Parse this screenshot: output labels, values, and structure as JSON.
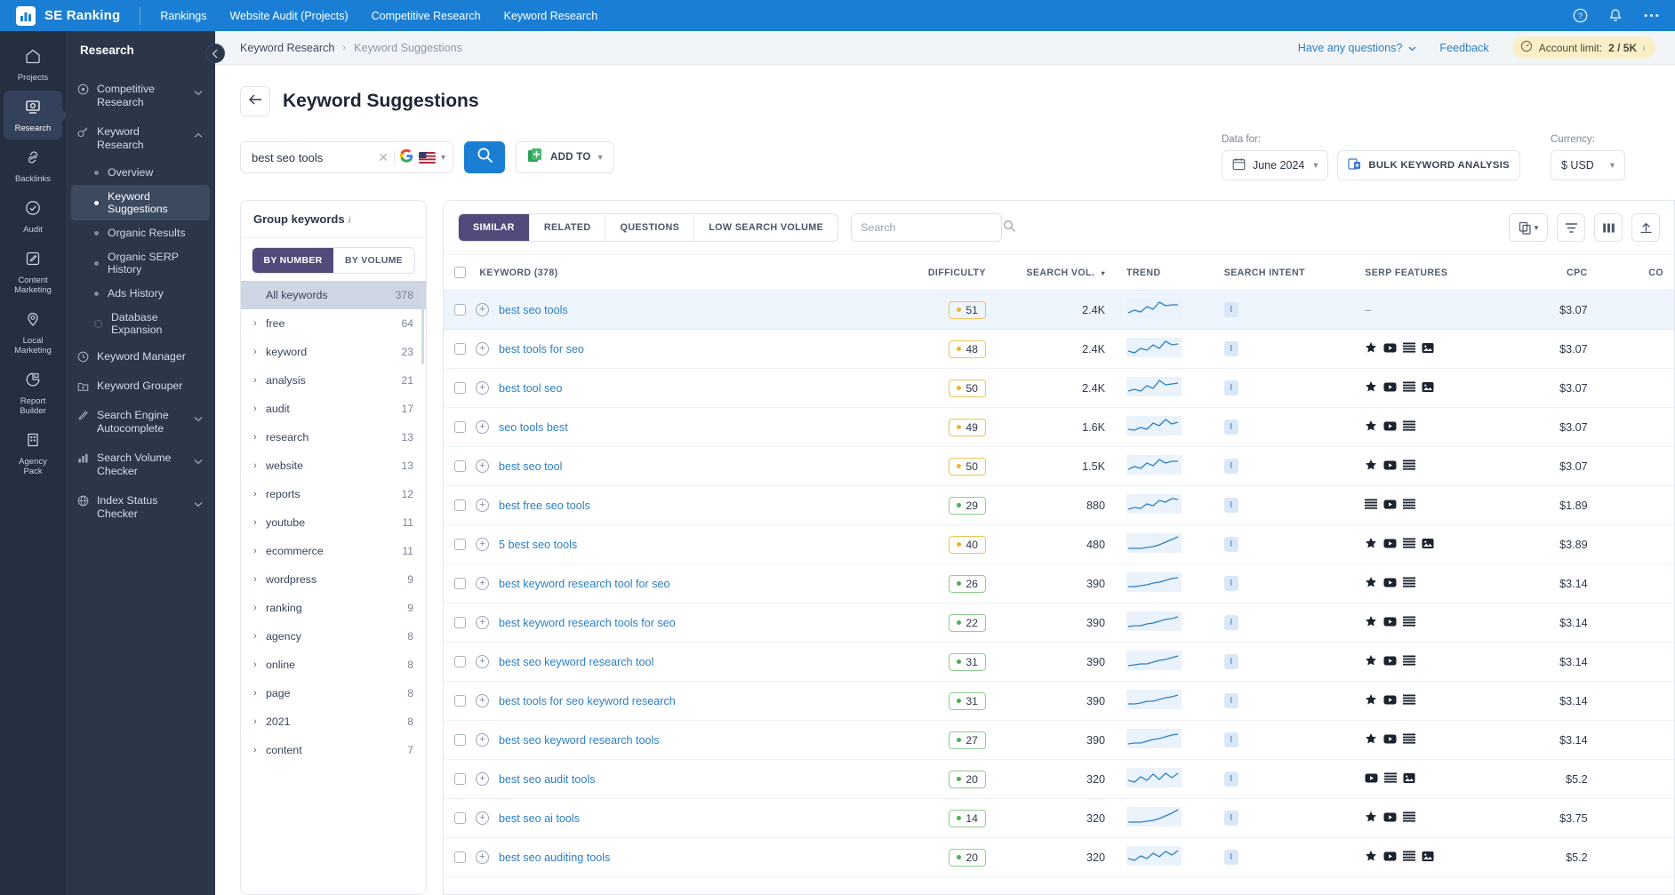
{
  "topbar": {
    "brand": "SE Ranking",
    "logo_icon": "bar-chart-icon",
    "nav": [
      {
        "label": "Rankings"
      },
      {
        "label": "Website Audit (Projects)"
      },
      {
        "label": "Competitive Research"
      },
      {
        "label": "Keyword Research"
      }
    ],
    "icons": [
      {
        "name": "help-icon",
        "glyph": "?"
      },
      {
        "name": "notifications-bell-icon",
        "glyph": "⚑"
      },
      {
        "name": "more-menu-icon",
        "glyph": "⋯"
      }
    ]
  },
  "rail": [
    {
      "label": "Projects",
      "icon": "home-icon"
    },
    {
      "label": "Research",
      "icon": "research-monitor-icon",
      "active": true
    },
    {
      "label": "Backlinks",
      "icon": "link-icon"
    },
    {
      "label": "Audit",
      "icon": "check-circle-icon"
    },
    {
      "label": "Content\nMarketing",
      "icon": "pencil-square-icon"
    },
    {
      "label": "Local\nMarketing",
      "icon": "map-pin-icon"
    },
    {
      "label": "Report\nBuilder",
      "icon": "pie-chart-icon"
    },
    {
      "label": "Agency\nPack",
      "icon": "building-icon"
    }
  ],
  "subnav": {
    "title": "Research",
    "collapse_icon": "chevron-left-icon",
    "groups": [
      {
        "label": "Competitive Research",
        "icon": "target-icon",
        "chevron": "chevron-down-icon"
      },
      {
        "label": "Keyword Research",
        "icon": "key-icon",
        "chevron": "chevron-up-icon",
        "expanded": true
      }
    ],
    "keyword_research_items": [
      {
        "label": "Overview",
        "active": false
      },
      {
        "label": "Keyword Suggestions",
        "active": true
      },
      {
        "label": "Organic Results",
        "active": false
      },
      {
        "label": "Organic SERP History",
        "active": false
      },
      {
        "label": "Ads History",
        "active": false
      },
      {
        "label": "Database Expansion",
        "active": false,
        "dotted": true
      }
    ],
    "bottom_groups": [
      {
        "label": "Keyword Manager",
        "icon": "clock-icon",
        "chevron": ""
      },
      {
        "label": "Keyword Grouper",
        "icon": "folder-plus-icon",
        "chevron": ""
      },
      {
        "label": "Search Engine Autocomplete",
        "icon": "pen-icon",
        "chevron": "chevron-down-icon"
      },
      {
        "label": "Search Volume Checker",
        "icon": "bars-icon",
        "chevron": "chevron-down-icon"
      },
      {
        "label": "Index Status Checker",
        "icon": "globe-icon",
        "chevron": "chevron-down-icon"
      }
    ]
  },
  "breadcrumb": {
    "parent": "Keyword Research",
    "separator": "›",
    "current": "Keyword Suggestions",
    "have_questions": "Have any questions?",
    "feedback": "Feedback",
    "account_limit_label": "Account limit:",
    "account_limit_value": "2 / 5K",
    "account_limit_sup": "i",
    "speedometer_icon": "gauge-icon"
  },
  "page": {
    "back_icon": "arrow-left-icon",
    "title": "Keyword Suggestions"
  },
  "search": {
    "keyword_value": "best seo tools",
    "clear_icon": "close-icon",
    "engine_icon": "google-icon",
    "country_flag": "us-flag-icon",
    "search_icon": "search-icon",
    "add_to_label": "ADD TO",
    "add_to_icon": "add-to-list-icon"
  },
  "controls": {
    "data_for_caption": "Data for:",
    "date_value": "June 2024",
    "calendar_icon": "calendar-icon",
    "bulk_label": "BULK KEYWORD ANALYSIS",
    "bulk_icon": "bulk-analysis-icon",
    "currency_caption": "Currency:",
    "currency_value": "$ USD"
  },
  "groups_panel": {
    "title": "Group keywords",
    "info_icon": "info-italic-icon",
    "segments": [
      {
        "label": "BY NUMBER",
        "active": true
      },
      {
        "label": "BY VOLUME",
        "active": false
      }
    ],
    "all_label": "All keywords",
    "all_count": "378",
    "rows": [
      {
        "name": "free",
        "count": "64"
      },
      {
        "name": "keyword",
        "count": "23"
      },
      {
        "name": "analysis",
        "count": "21"
      },
      {
        "name": "audit",
        "count": "17"
      },
      {
        "name": "research",
        "count": "13"
      },
      {
        "name": "website",
        "count": "13"
      },
      {
        "name": "reports",
        "count": "12"
      },
      {
        "name": "youtube",
        "count": "11"
      },
      {
        "name": "ecommerce",
        "count": "11"
      },
      {
        "name": "wordpress",
        "count": "9"
      },
      {
        "name": "ranking",
        "count": "9"
      },
      {
        "name": "agency",
        "count": "8"
      },
      {
        "name": "online",
        "count": "8"
      },
      {
        "name": "page",
        "count": "8"
      },
      {
        "name": "2021",
        "count": "8"
      },
      {
        "name": "content",
        "count": "7"
      }
    ]
  },
  "table_toolbar": {
    "tabs": [
      {
        "label": "SIMILAR",
        "active": true
      },
      {
        "label": "RELATED",
        "active": false
      },
      {
        "label": "QUESTIONS",
        "active": false
      },
      {
        "label": "LOW SEARCH VOLUME",
        "active": false
      }
    ],
    "search_placeholder": "Search",
    "search_icon": "search-icon",
    "buttons": [
      {
        "name": "columns-copy-icon",
        "has_chevron": true
      },
      {
        "name": "filter-icon",
        "has_chevron": false
      },
      {
        "name": "view-columns-icon",
        "has_chevron": false
      },
      {
        "name": "export-upload-icon",
        "has_chevron": false
      }
    ]
  },
  "table": {
    "columns": [
      {
        "label": "KEYWORD (378)",
        "align": "left"
      },
      {
        "label": "DIFFICULTY",
        "align": "right"
      },
      {
        "label": "SEARCH VOL.",
        "align": "right",
        "sort_icon": "chevron-down-icon"
      },
      {
        "label": "TREND",
        "align": "left"
      },
      {
        "label": "SEARCH INTENT",
        "align": "left"
      },
      {
        "label": "SERP FEATURES",
        "align": "left"
      },
      {
        "label": "CPC",
        "align": "right"
      },
      {
        "label": "CO",
        "align": "right"
      }
    ],
    "rows": [
      {
        "keyword": "best seo tools",
        "difficulty": "51",
        "difficulty_color": "yellow",
        "volume": "2.4K",
        "intent": "I",
        "serp": [],
        "serp_dash": "–",
        "cpc": "$3.07",
        "highlight": true
      },
      {
        "keyword": "best tools for seo",
        "difficulty": "48",
        "difficulty_color": "yellow",
        "volume": "2.4K",
        "intent": "I",
        "serp": [
          "star-icon",
          "video-icon",
          "list-icon",
          "image-icon"
        ],
        "cpc": "$3.07"
      },
      {
        "keyword": "best tool seo",
        "difficulty": "50",
        "difficulty_color": "yellow",
        "volume": "2.4K",
        "intent": "I",
        "serp": [
          "star-icon",
          "video-icon",
          "list-icon",
          "image-icon"
        ],
        "cpc": "$3.07"
      },
      {
        "keyword": "seo tools best",
        "difficulty": "49",
        "difficulty_color": "yellow",
        "volume": "1.6K",
        "intent": "I",
        "serp": [
          "star-icon",
          "video-icon",
          "list-icon"
        ],
        "cpc": "$3.07"
      },
      {
        "keyword": "best seo tool",
        "difficulty": "50",
        "difficulty_color": "yellow",
        "volume": "1.5K",
        "intent": "I",
        "serp": [
          "star-icon",
          "video-icon",
          "list-icon"
        ],
        "cpc": "$3.07"
      },
      {
        "keyword": "best free seo tools",
        "difficulty": "29",
        "difficulty_color": "green",
        "volume": "880",
        "intent": "I",
        "serp": [
          "list-icon",
          "video-icon",
          "list-icon"
        ],
        "cpc": "$1.89"
      },
      {
        "keyword": "5 best seo tools",
        "difficulty": "40",
        "difficulty_color": "yellow",
        "volume": "480",
        "intent": "I",
        "serp": [
          "star-icon",
          "video-icon",
          "list-icon",
          "image-icon"
        ],
        "cpc": "$3.89"
      },
      {
        "keyword": "best keyword research tool for seo",
        "difficulty": "26",
        "difficulty_color": "green",
        "volume": "390",
        "intent": "I",
        "serp": [
          "star-icon",
          "video-icon",
          "list-icon"
        ],
        "cpc": "$3.14"
      },
      {
        "keyword": "best keyword research tools for seo",
        "difficulty": "22",
        "difficulty_color": "green",
        "volume": "390",
        "intent": "I",
        "serp": [
          "star-icon",
          "video-icon",
          "list-icon"
        ],
        "cpc": "$3.14"
      },
      {
        "keyword": "best seo keyword research tool",
        "difficulty": "31",
        "difficulty_color": "green",
        "volume": "390",
        "intent": "I",
        "serp": [
          "star-icon",
          "video-icon",
          "list-icon"
        ],
        "cpc": "$3.14"
      },
      {
        "keyword": "best tools for seo keyword research",
        "difficulty": "31",
        "difficulty_color": "green",
        "volume": "390",
        "intent": "I",
        "serp": [
          "star-icon",
          "video-icon",
          "list-icon"
        ],
        "cpc": "$3.14"
      },
      {
        "keyword": "best seo keyword research tools",
        "difficulty": "27",
        "difficulty_color": "green",
        "volume": "390",
        "intent": "I",
        "serp": [
          "star-icon",
          "video-icon",
          "list-icon"
        ],
        "cpc": "$3.14"
      },
      {
        "keyword": "best seo audit tools",
        "difficulty": "20",
        "difficulty_color": "green",
        "volume": "320",
        "intent": "I",
        "serp": [
          "video-icon",
          "list-icon",
          "image-icon"
        ],
        "cpc": "$5.2"
      },
      {
        "keyword": "best seo ai tools",
        "difficulty": "14",
        "difficulty_color": "green",
        "volume": "320",
        "intent": "I",
        "serp": [
          "star-icon",
          "video-icon",
          "list-icon"
        ],
        "cpc": "$3.75"
      },
      {
        "keyword": "best seo auditing tools",
        "difficulty": "20",
        "difficulty_color": "green",
        "volume": "320",
        "intent": "I",
        "serp": [
          "star-icon",
          "video-icon",
          "list-icon",
          "image-icon"
        ],
        "cpc": "$5.2"
      }
    ]
  },
  "colors": {
    "brand_blue": "#1a7fd4",
    "rail_dark": "#242f3f",
    "subnav_dark": "#2b3749",
    "purple_active": "#514a7a",
    "link_blue": "#2c7fc4",
    "yellow_badge": "#f0b429",
    "green_badge": "#4caf50",
    "highlight_row": "#eef5fd"
  }
}
